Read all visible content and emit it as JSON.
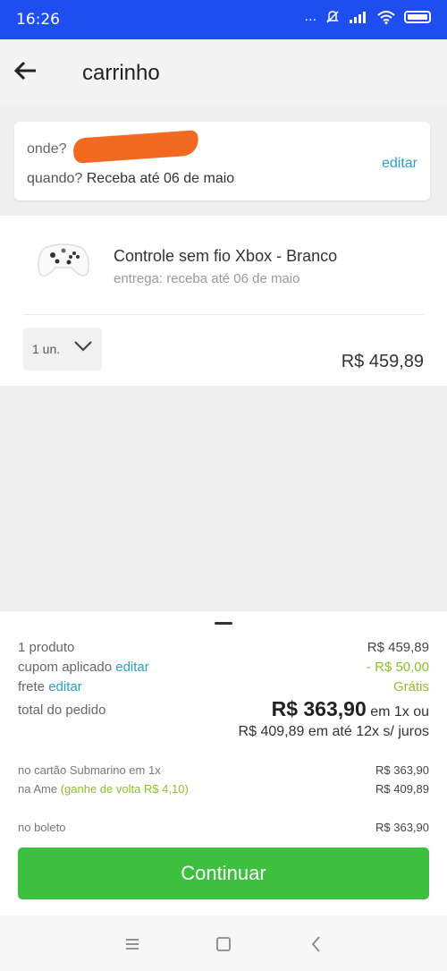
{
  "status_bar": {
    "time": "16:26",
    "dots": "...",
    "icons": [
      "mute-icon",
      "signal-icon",
      "wifi-icon",
      "battery-icon"
    ]
  },
  "header": {
    "title": "carrinho",
    "back_icon": "arrow-left-icon"
  },
  "delivery": {
    "where_label": "onde?",
    "when_label": "quando?",
    "when_value": "Receba até 06 de maio",
    "edit_label": "editar"
  },
  "product": {
    "name": "Controle sem fio Xbox - Branco",
    "delivery": "entrega: receba até 06 de maio",
    "quantity": "1 un.",
    "price": "R$ 459,89"
  },
  "summary": {
    "items_label": "1 produto",
    "items_value": "R$ 459,89",
    "coupon_label": "cupom aplicado",
    "coupon_edit": "editar",
    "coupon_value": "- R$ 50,00",
    "shipping_label": "frete",
    "shipping_edit": "editar",
    "shipping_value": "Grátis",
    "total_label": "total do pedido",
    "total_value": "R$ 363,90",
    "total_suffix": "em 1x ou",
    "installments": "R$ 409,89 em até 12x s/ juros"
  },
  "payment_methods": [
    {
      "label": "no cartão Submarino em 1x",
      "value": "R$ 363,90"
    },
    {
      "label": "na Ame",
      "bonus": "(ganhe de volta R$ 4,10)",
      "value": "R$ 409,89"
    },
    {
      "label": "no boleto",
      "value": "R$ 363,90"
    }
  ],
  "cta": {
    "label": "Continuar"
  },
  "colors": {
    "status_bar": "#1f4ef0",
    "link": "#2a9fc9",
    "discount": "#8cbf2a",
    "cta": "#3dbf40",
    "redaction": "#f26a21"
  },
  "nav_bar": {
    "icons": [
      "menu-icon",
      "home-square-icon",
      "back-chevron-icon"
    ]
  }
}
